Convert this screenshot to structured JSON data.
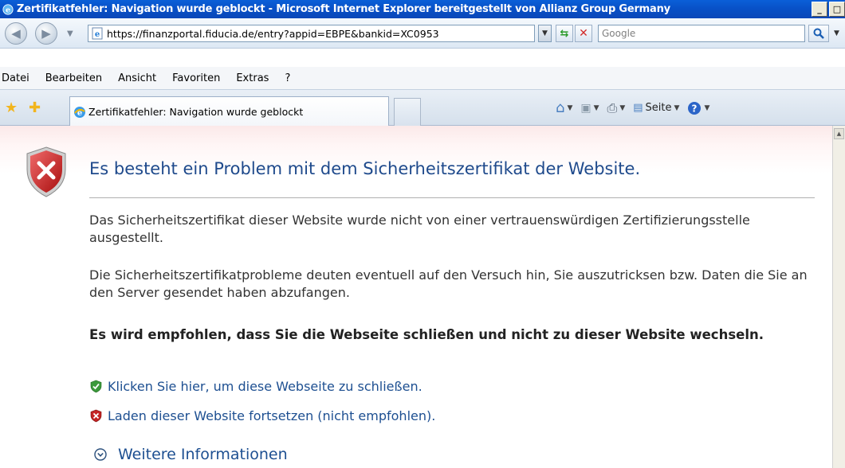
{
  "window": {
    "title": "Zertifikatfehler: Navigation wurde geblockt - Microsoft Internet Explorer bereitgestellt von Allianz Group Germany",
    "minimize": "_",
    "restore": "□"
  },
  "address_bar": {
    "url": "https://finanzportal.fiducia.de/entry?appid=EBPE&bankid=XC0953",
    "search_placeholder": "Google"
  },
  "menu": {
    "items": [
      "Datei",
      "Bearbeiten",
      "Ansicht",
      "Favoriten",
      "Extras",
      "?"
    ]
  },
  "tab": {
    "label": "Zertifikatfehler: Navigation wurde geblockt"
  },
  "command_bar": {
    "page_label": "Seite"
  },
  "page": {
    "headline": "Es besteht ein Problem mit dem Sicherheitszertifikat der Website.",
    "paragraph1": "Das Sicherheitszertifikat dieser Website wurde nicht von einer vertrauenswürdigen Zertifizierungsstelle ausgestellt.",
    "paragraph2": "Die Sicherheitszertifikatprobleme deuten eventuell auf den Versuch hin, Sie auszutricksen bzw. Daten die Sie an den Server gesendet haben abzufangen.",
    "recommendation": "Es wird empfohlen, dass Sie die Webseite schließen und nicht zu dieser Website wechseln.",
    "link_close": "Klicken Sie hier, um diese Webseite zu schließen.",
    "link_continue": "Laden dieser Website fortsetzen (nicht empfohlen).",
    "more_info": "Weitere Informationen"
  },
  "colors": {
    "link": "#1d4f91",
    "headline": "#1f4a8c",
    "titlebar": "#0a5fd8"
  },
  "icons": [
    "ie-logo-icon",
    "back-icon",
    "forward-icon",
    "refresh-icon",
    "stop-icon",
    "search-icon",
    "favorites-star-icon",
    "add-favorites-icon",
    "home-icon",
    "feeds-icon",
    "print-icon",
    "page-icon",
    "help-icon",
    "shield-error-icon",
    "shield-ok-icon",
    "shield-warning-icon",
    "expand-circle-icon"
  ]
}
